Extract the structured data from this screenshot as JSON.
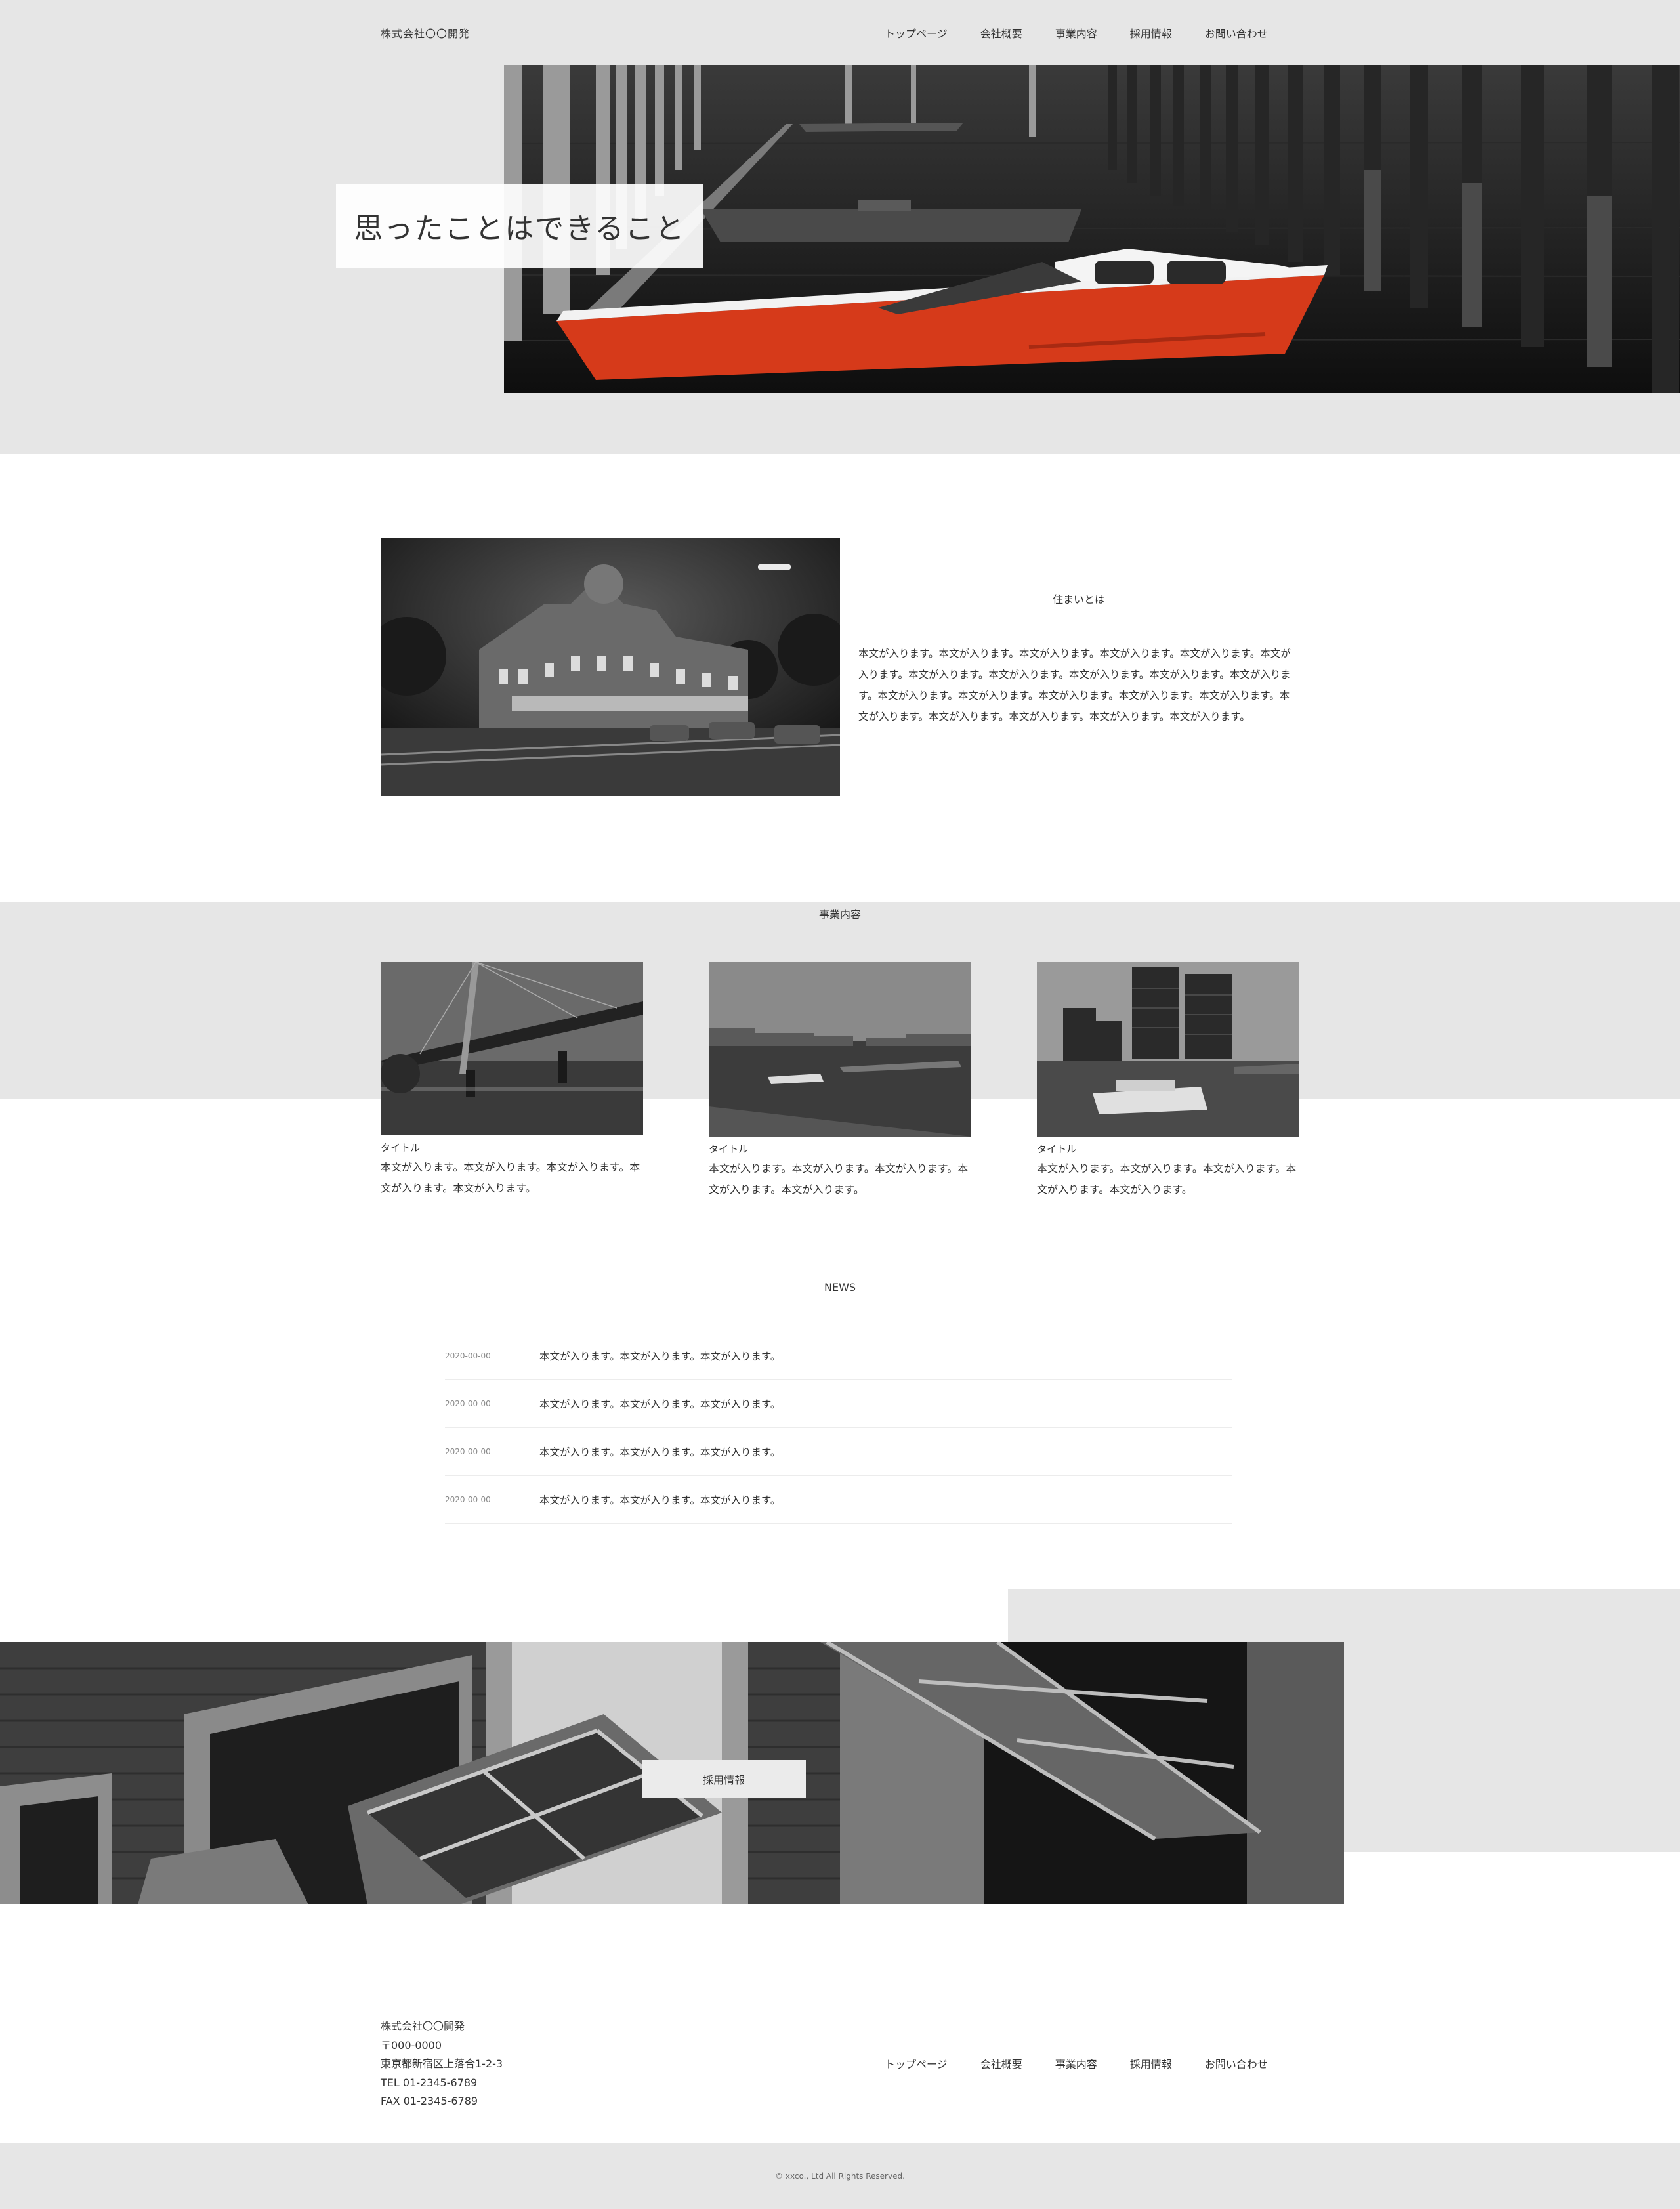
{
  "header": {
    "logo": "株式会社〇〇開発",
    "nav": [
      "トップページ",
      "会社概要",
      "事業内容",
      "採用情報",
      "お問い合わせ"
    ]
  },
  "hero": {
    "catch": "思ったことはできること"
  },
  "about": {
    "title": "住まいとは",
    "body": "本文が入ります。本文が入ります。本文が入ります。本文が入ります。本文が入ります。本文が入ります。本文が入ります。本文が入ります。本文が入ります。本文が入ります。本文が入ります。本文が入ります。本文が入ります。本文が入ります。本文が入ります。本文が入ります。本文が入ります。本文が入ります。本文が入ります。本文が入ります。本文が入ります。"
  },
  "business": {
    "title": "事業内容",
    "cards": [
      {
        "label": "タイトル",
        "text": "本文が入ります。本文が入ります。本文が入ります。本文が入ります。本文が入ります。"
      },
      {
        "label": "タイトル",
        "text": "本文が入ります。本文が入ります。本文が入ります。本文が入ります。本文が入ります。"
      },
      {
        "label": "タイトル",
        "text": "本文が入ります。本文が入ります。本文が入ります。本文が入ります。本文が入ります。"
      }
    ]
  },
  "news": {
    "title": "NEWS",
    "items": [
      {
        "date": "2020-00-00",
        "text": "本文が入ります。本文が入ります。本文が入ります。"
      },
      {
        "date": "2020-00-00",
        "text": "本文が入ります。本文が入ります。本文が入ります。"
      },
      {
        "date": "2020-00-00",
        "text": "本文が入ります。本文が入ります。本文が入ります。"
      },
      {
        "date": "2020-00-00",
        "text": "本文が入ります。本文が入ります。本文が入ります。"
      }
    ]
  },
  "recruit": {
    "button": "採用情報"
  },
  "footer": {
    "company": "株式会社〇〇開発",
    "postal": "〒000-0000",
    "address": "東京都新宿区上落合1-2-3",
    "tel": "TEL 01-2345-6789",
    "fax": "FAX 01-2345-6789",
    "nav": [
      "トップページ",
      "会社概要",
      "事業内容",
      "採用情報",
      "お問い合わせ"
    ],
    "copyright": "© xxco., Ltd All Rights Reserved."
  },
  "colors": {
    "gray_bg": "#e6e6e6",
    "accent_boat": "#d63a1a"
  }
}
